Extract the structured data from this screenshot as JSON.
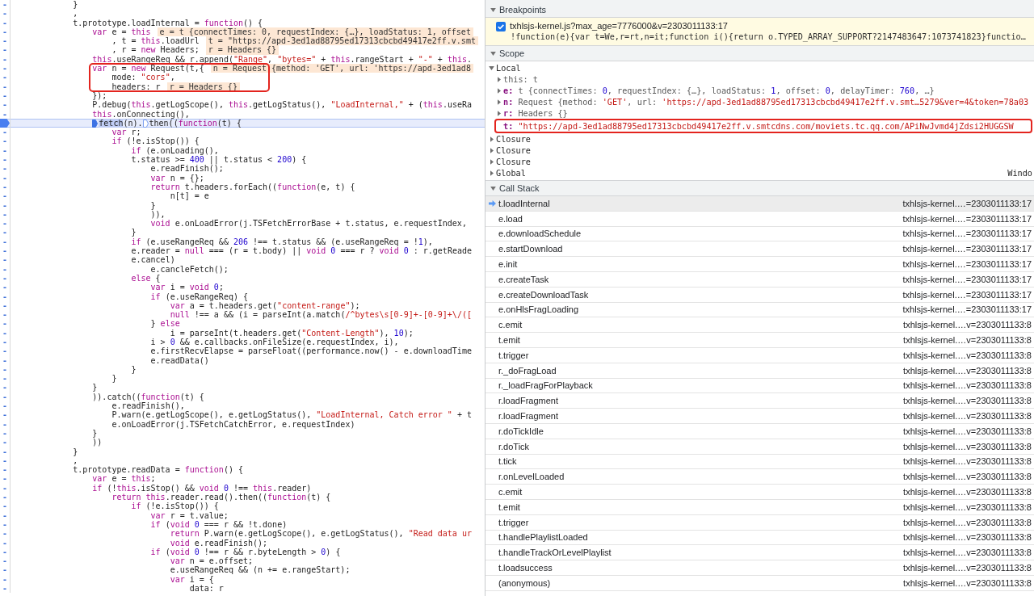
{
  "code_editor": {
    "lines": [
      {
        "gutter": "-",
        "breakpoint": false,
        "current": false,
        "framed": false,
        "code": [
          "}"
        ]
      },
      {
        "gutter": "-",
        "breakpoint": false,
        "current": false,
        "framed": false,
        "code": [
          ","
        ]
      },
      {
        "gutter": "-",
        "breakpoint": false,
        "current": false,
        "framed": false,
        "code": [
          "t.prototype.loadInternal = ",
          {
            "kind": "keyword",
            "text": "function"
          },
          "() {"
        ],
        "children": [
          {
            "gutter": "-",
            "breakpoint": false,
            "current": false,
            "framed": false,
            "code": [
              {
                "kind": "keyword",
                "text": "var"
              },
              " e = ",
              {
                "kind": "keyword",
                "text": "this"
              }
            ],
            "inline_value": "e = t {connectTimes: 0, requestIndex: {…}, loadStatus: 1, offset",
            "children": [
              {
                "gutter": "-",
                "breakpoint": false,
                "current": false,
                "framed": false,
                "code": [
                  ", t = ",
                  {
                    "kind": "keyword",
                    "text": "this"
                  },
                  ".loadUrl"
                ],
                "inline_value": "t = \"https://apd-3ed1ad88795ed17313cbcbd49417e2ff.v.smt"
              },
              {
                "gutter": "-",
                "breakpoint": false,
                "current": false,
                "framed": false,
                "code": [
                  ", r = ",
                  {
                    "kind": "keyword",
                    "text": "new"
                  },
                  " Headers;"
                ],
                "inline_value": "r = Headers {}"
              }
            ]
          },
          {
            "gutter": "-",
            "breakpoint": false,
            "current": false,
            "framed": false,
            "code": [
              {
                "kind": "keyword",
                "text": "this"
              },
              ".useRangeReq && r.append(",
              {
                "kind": "string",
                "text": "\"Range\""
              },
              ", ",
              {
                "kind": "string",
                "text": "\"bytes=\""
              },
              " + ",
              {
                "kind": "keyword",
                "text": "this"
              },
              ".rangeStart + ",
              {
                "kind": "string",
                "text": "\"-\""
              },
              " + ",
              {
                "kind": "keyword",
                "text": "this"
              },
              "."
            ]
          },
          {
            "gutter": "-",
            "breakpoint": false,
            "current": false,
            "framed": true,
            "code": [
              {
                "kind": "keyword",
                "text": "var"
              },
              " n = ",
              {
                "kind": "keyword",
                "text": "new"
              },
              " Request(t,{"
            ],
            "inline_value": "n = Request {method: 'GET', url: 'https://apd-3ed1ad8",
            "children": [
              {
                "gutter": "-",
                "breakpoint": false,
                "current": false,
                "framed": true,
                "code": [
                  "mode: ",
                  {
                    "kind": "string",
                    "text": "\"cors\""
                  },
                  ","
                ]
              },
              {
                "gutter": "-",
                "breakpoint": false,
                "current": false,
                "framed": true,
                "code": [
                  "headers: r"
                ],
                "inline_value": "r = Headers {}"
              }
            ]
          },
          {
            "gutter": "-",
            "breakpoint": false,
            "current": false,
            "framed": false,
            "code": [
              "});"
            ]
          },
          {
            "gutter": "-",
            "breakpoint": false,
            "current": false,
            "framed": false,
            "code": [
              "P.debug(",
              {
                "kind": "keyword",
                "text": "this"
              },
              ".getLogScope(), ",
              {
                "kind": "keyword",
                "text": "this"
              },
              ".getLogStatus(), ",
              {
                "kind": "string",
                "text": "\"LoadInternal,\""
              },
              " + (",
              {
                "kind": "keyword",
                "text": "this"
              },
              ".useRa"
            ]
          },
          {
            "gutter": "-",
            "breakpoint": false,
            "current": false,
            "framed": false,
            "code": [
              {
                "kind": "keyword",
                "text": "this"
              },
              ".onConnecting(),"
            ]
          },
          {
            "breakpoint": true,
            "current": true,
            "framed": false,
            "code": [
              {
                "kind": "marker",
                "active": true
              },
              {
                "kind": "selection",
                "text": "fetch"
              },
              "(n).",
              {
                "kind": "marker",
                "active": false
              },
              "then((",
              {
                "kind": "keyword",
                "text": "function"
              },
              "(t) {"
            ],
            "children": [
              {
                "gutter": "-",
                "breakpoint": false,
                "current": false,
                "framed": false,
                "code": [
                  {
                    "kind": "keyword",
                    "text": "var"
                  },
                  " r;"
                ]
              },
              {
                "gutter": "-",
                "breakpoint": false,
                "current": false,
                "framed": false,
                "code": [
                  {
                    "kind": "keyword",
                    "text": "if"
                  },
                  " (!e.isStop()) {"
                ],
                "children": [
                  {
                    "gutter": "-",
                    "breakpoint": false,
                    "current": false,
                    "framed": false,
                    "code": [
                      {
                        "kind": "keyword",
                        "text": "if"
                      },
                      " (e.onLoading(),"
                    ]
                  },
                  {
                    "gutter": "-",
                    "breakpoint": false,
                    "current": false,
                    "framed": false,
                    "code": [
                      "t.status >= ",
                      {
                        "kind": "number",
                        "text": "400"
                      },
                      " || t.status < ",
                      {
                        "kind": "number",
                        "text": "200"
                      },
                      ") {"
                    ],
                    "children": [
                      {
                        "gutter": "-",
                        "breakpoint": false,
                        "current": false,
                        "framed": false,
                        "code": [
                          "e.readFinish();"
                        ]
                      },
                      {
                        "gutter": "-",
                        "breakpoint": false,
                        "current": false,
                        "framed": false,
                        "code": [
                          {
                            "kind": "keyword",
                            "text": "var"
                          },
                          " n = {};"
                        ]
                      },
                      {
                        "gutter": "-",
                        "breakpoint": false,
                        "current": false,
                        "framed": false,
                        "code": [
                          {
                            "kind": "keyword",
                            "text": "return"
                          },
                          " t.headers.forEach((",
                          {
                            "kind": "keyword",
                            "text": "function"
                          },
                          "(e, t) {"
                        ],
                        "children": [
                          {
                            "gutter": "-",
                            "breakpoint": false,
                            "current": false,
                            "framed": false,
                            "code": [
                              "n[t] = e"
                            ]
                          }
                        ]
                      },
                      {
                        "gutter": "-",
                        "breakpoint": false,
                        "current": false,
                        "framed": false,
                        "code": [
                          "}"
                        ]
                      },
                      {
                        "gutter": "-",
                        "breakpoint": false,
                        "current": false,
                        "framed": false,
                        "code": [
                          ")),"
                        ]
                      },
                      {
                        "gutter": "-",
                        "breakpoint": false,
                        "current": false,
                        "framed": false,
                        "code": [
                          {
                            "kind": "keyword",
                            "text": "void"
                          },
                          " e.onLoadError(j.TSFetchErrorBase + t.status, e.requestIndex,"
                        ]
                      }
                    ]
                  },
                  {
                    "gutter": "-",
                    "breakpoint": false,
                    "current": false,
                    "framed": false,
                    "code": [
                      "}"
                    ]
                  },
                  {
                    "gutter": "-",
                    "breakpoint": false,
                    "current": false,
                    "framed": false,
                    "code": [
                      {
                        "kind": "keyword",
                        "text": "if"
                      },
                      " (e.useRangeReq && ",
                      {
                        "kind": "number",
                        "text": "206"
                      },
                      " !== t.status && (e.useRangeReq = !",
                      {
                        "kind": "number",
                        "text": "1"
                      },
                      "),"
                    ]
                  },
                  {
                    "gutter": "-",
                    "breakpoint": false,
                    "current": false,
                    "framed": false,
                    "code": [
                      "e.reader = ",
                      {
                        "kind": "keyword",
                        "text": "null"
                      },
                      " === (r = t.body) || ",
                      {
                        "kind": "keyword",
                        "text": "void "
                      },
                      {
                        "kind": "number",
                        "text": "0"
                      },
                      " === r ? ",
                      {
                        "kind": "keyword",
                        "text": "void "
                      },
                      {
                        "kind": "number",
                        "text": "0"
                      },
                      " : r.getReade"
                    ]
                  },
                  {
                    "gutter": "-",
                    "breakpoint": false,
                    "current": false,
                    "framed": false,
                    "code": [
                      "e.cancel)"
                    ],
                    "children": [
                      {
                        "gutter": "-",
                        "breakpoint": false,
                        "current": false,
                        "framed": false,
                        "code": [
                          "e.cancleFetch();"
                        ]
                      }
                    ]
                  },
                  {
                    "gutter": "-",
                    "breakpoint": false,
                    "current": false,
                    "framed": false,
                    "code": [
                      {
                        "kind": "keyword",
                        "text": "else"
                      },
                      " {"
                    ],
                    "children": [
                      {
                        "gutter": "-",
                        "breakpoint": false,
                        "current": false,
                        "framed": false,
                        "code": [
                          {
                            "kind": "keyword",
                            "text": "var"
                          },
                          " i = ",
                          {
                            "kind": "keyword",
                            "text": "void "
                          },
                          {
                            "kind": "number",
                            "text": "0"
                          },
                          ";"
                        ]
                      },
                      {
                        "gutter": "-",
                        "breakpoint": false,
                        "current": false,
                        "framed": false,
                        "code": [
                          {
                            "kind": "keyword",
                            "text": "if"
                          },
                          " (e.useRangeReq) {"
                        ],
                        "children": [
                          {
                            "gutter": "-",
                            "breakpoint": false,
                            "current": false,
                            "framed": false,
                            "code": [
                              {
                                "kind": "keyword",
                                "text": "var"
                              },
                              " a = t.headers.get(",
                              {
                                "kind": "string",
                                "text": "\"content-range\""
                              },
                              ");"
                            ]
                          },
                          {
                            "gutter": "-",
                            "breakpoint": false,
                            "current": false,
                            "framed": false,
                            "code": [
                              {
                                "kind": "keyword",
                                "text": "null"
                              },
                              " !== a && (i = parseInt(a.match(",
                              {
                                "kind": "regex",
                                "text": "/^bytes\\s[0-9]+-[0-9]+\\/(["
                              }
                            ]
                          }
                        ]
                      },
                      {
                        "gutter": "-",
                        "breakpoint": false,
                        "current": false,
                        "framed": false,
                        "code": [
                          "} ",
                          {
                            "kind": "keyword",
                            "text": "else"
                          }
                        ],
                        "children": [
                          {
                            "gutter": "-",
                            "breakpoint": false,
                            "current": false,
                            "framed": false,
                            "code": [
                              "i = parseInt(t.headers.get(",
                              {
                                "kind": "string",
                                "text": "\"Content-Length\""
                              },
                              "), ",
                              {
                                "kind": "number",
                                "text": "10"
                              },
                              ");"
                            ]
                          }
                        ]
                      },
                      {
                        "gutter": "-",
                        "breakpoint": false,
                        "current": false,
                        "framed": false,
                        "code": [
                          "i > ",
                          {
                            "kind": "number",
                            "text": "0"
                          },
                          " && e.callbacks.onFileSize(e.requestIndex, i),"
                        ]
                      },
                      {
                        "gutter": "-",
                        "breakpoint": false,
                        "current": false,
                        "framed": false,
                        "code": [
                          "e.firstRecvElapse = parseFloat((performance.now() - e.downloadTime"
                        ]
                      },
                      {
                        "gutter": "-",
                        "breakpoint": false,
                        "current": false,
                        "framed": false,
                        "code": [
                          "e.readData()"
                        ]
                      }
                    ]
                  },
                  {
                    "gutter": "-",
                    "breakpoint": false,
                    "current": false,
                    "framed": false,
                    "code": [
                      "}"
                    ]
                  }
                ]
              },
              {
                "gutter": "-",
                "breakpoint": false,
                "current": false,
                "framed": false,
                "code": [
                  "}"
                ]
              }
            ]
          },
          {
            "gutter": "-",
            "breakpoint": false,
            "current": false,
            "framed": false,
            "code": [
              "}"
            ]
          },
          {
            "gutter": "-",
            "breakpoint": false,
            "current": false,
            "framed": false,
            "code": [
              ")).catch((",
              {
                "kind": "keyword",
                "text": "function"
              },
              "(t) {"
            ],
            "children": [
              {
                "gutter": "-",
                "breakpoint": false,
                "current": false,
                "framed": false,
                "code": [
                  "e.readFinish(),"
                ]
              },
              {
                "gutter": "-",
                "breakpoint": false,
                "current": false,
                "framed": false,
                "code": [
                  "P.warn(e.getLogScope(), e.getLogStatus(), ",
                  {
                    "kind": "string",
                    "text": "\"LoadInternal, Catch error \""
                  },
                  " + t"
                ]
              },
              {
                "gutter": "-",
                "breakpoint": false,
                "current": false,
                "framed": false,
                "code": [
                  "e.onLoadError(j.TSFetchCatchError, e.requestIndex)"
                ]
              }
            ]
          },
          {
            "gutter": "-",
            "breakpoint": false,
            "current": false,
            "framed": false,
            "code": [
              "}"
            ]
          },
          {
            "gutter": "-",
            "breakpoint": false,
            "current": false,
            "framed": false,
            "code": [
              "))"
            ]
          }
        ]
      },
      {
        "gutter": "-",
        "breakpoint": false,
        "current": false,
        "framed": false,
        "code": [
          "}"
        ]
      },
      {
        "gutter": "-",
        "breakpoint": false,
        "current": false,
        "framed": false,
        "code": [
          ","
        ]
      },
      {
        "gutter": "-",
        "breakpoint": false,
        "current": false,
        "framed": false,
        "code": [
          "t.prototype.readData = ",
          {
            "kind": "keyword",
            "text": "function"
          },
          "() {"
        ],
        "children": [
          {
            "gutter": "-",
            "breakpoint": false,
            "current": false,
            "framed": false,
            "code": [
              {
                "kind": "keyword",
                "text": "var"
              },
              " e = ",
              {
                "kind": "keyword",
                "text": "this"
              },
              ";"
            ]
          },
          {
            "gutter": "-",
            "breakpoint": false,
            "current": false,
            "framed": false,
            "code": [
              {
                "kind": "keyword",
                "text": "if"
              },
              " (!",
              {
                "kind": "keyword",
                "text": "this"
              },
              ".isStop() && ",
              {
                "kind": "keyword",
                "text": "void "
              },
              {
                "kind": "number",
                "text": "0"
              },
              " !== ",
              {
                "kind": "keyword",
                "text": "this"
              },
              ".reader)"
            ],
            "children": [
              {
                "gutter": "-",
                "breakpoint": false,
                "current": false,
                "framed": false,
                "code": [
                  {
                    "kind": "keyword",
                    "text": "return this"
                  },
                  ".reader.read().then((",
                  {
                    "kind": "keyword",
                    "text": "function"
                  },
                  "(t) {"
                ],
                "children": [
                  {
                    "gutter": "-",
                    "breakpoint": false,
                    "current": false,
                    "framed": false,
                    "code": [
                      {
                        "kind": "keyword",
                        "text": "if"
                      },
                      " (!e.isStop()) {"
                    ],
                    "children": [
                      {
                        "gutter": "-",
                        "breakpoint": false,
                        "current": false,
                        "framed": false,
                        "code": [
                          {
                            "kind": "keyword",
                            "text": "var"
                          },
                          " r = t.value;"
                        ]
                      },
                      {
                        "gutter": "-",
                        "breakpoint": false,
                        "current": false,
                        "framed": false,
                        "code": [
                          {
                            "kind": "keyword",
                            "text": "if"
                          },
                          " (",
                          {
                            "kind": "keyword",
                            "text": "void "
                          },
                          {
                            "kind": "number",
                            "text": "0"
                          },
                          " === r && !t.done)"
                        ],
                        "children": [
                          {
                            "gutter": "-",
                            "breakpoint": false,
                            "current": false,
                            "framed": false,
                            "code": [
                              {
                                "kind": "keyword",
                                "text": "return"
                              },
                              " P.warn(e.getLogScope(), e.getLogStatus(), ",
                              {
                                "kind": "string",
                                "text": "\"Read data ur"
                              }
                            ]
                          },
                          {
                            "gutter": "-",
                            "breakpoint": false,
                            "current": false,
                            "framed": false,
                            "code": [
                              {
                                "kind": "keyword",
                                "text": "void"
                              },
                              " e.readFinish();"
                            ]
                          }
                        ]
                      },
                      {
                        "gutter": "-",
                        "breakpoint": false,
                        "current": false,
                        "framed": false,
                        "code": [
                          {
                            "kind": "keyword",
                            "text": "if"
                          },
                          " (",
                          {
                            "kind": "keyword",
                            "text": "void "
                          },
                          {
                            "kind": "number",
                            "text": "0"
                          },
                          " !== r && r.byteLength > ",
                          {
                            "kind": "number",
                            "text": "0"
                          },
                          ") {"
                        ],
                        "children": [
                          {
                            "gutter": "-",
                            "breakpoint": false,
                            "current": false,
                            "framed": false,
                            "code": [
                              {
                                "kind": "keyword",
                                "text": "var"
                              },
                              " n = e.offset;"
                            ]
                          },
                          {
                            "gutter": "-",
                            "breakpoint": false,
                            "current": false,
                            "framed": false,
                            "code": [
                              "e.useRangeReq && (n += e.rangeStart);"
                            ]
                          },
                          {
                            "gutter": "-",
                            "breakpoint": false,
                            "current": false,
                            "framed": false,
                            "code": [
                              {
                                "kind": "keyword",
                                "text": "var"
                              },
                              " i = {"
                            ],
                            "children": [
                              {
                                "gutter": "-",
                                "breakpoint": false,
                                "current": false,
                                "framed": false,
                                "code": [
                                  "data: r"
                                ]
                              }
                            ]
                          }
                        ]
                      }
                    ]
                  }
                ]
              }
            ]
          }
        ]
      }
    ]
  },
  "sidebar": {
    "breakpoints": {
      "title": "Breakpoints",
      "expanded": true,
      "items": [
        {
          "checked": true,
          "location": "txhlsjs-kernel.js?max_age=7776000&v=2303011133:17",
          "snippet": "!function(e){var t=We,r=rt,n=it;function i(){return o.TYPED_ARRAY_SUPPORT?2147483647:1073741823}functio…"
        }
      ]
    },
    "scope": {
      "title": "Scope",
      "expanded": true,
      "items": [
        {
          "kind": "group",
          "label": "Local",
          "expanded": true,
          "children": [
            {
              "kind": "property",
              "expanded": false,
              "framed": false,
              "entry": [
                "this: t"
              ]
            },
            {
              "kind": "property",
              "expanded": false,
              "framed": false,
              "entry": [
                {
                  "kind": "name",
                  "text": "e:"
                },
                " t {connectTimes: ",
                {
                  "kind": "number",
                  "text": "0"
                },
                ", requestIndex: {…}, loadStatus: ",
                {
                  "kind": "number",
                  "text": "1"
                },
                ", offset: ",
                {
                  "kind": "number",
                  "text": "0"
                },
                ", delayTimer: ",
                {
                  "kind": "number",
                  "text": "760"
                },
                ", …}"
              ]
            },
            {
              "kind": "property",
              "expanded": false,
              "framed": false,
              "entry": [
                {
                  "kind": "name",
                  "text": "n:"
                },
                " Request {method: ",
                {
                  "kind": "string",
                  "text": "'GET'"
                },
                ", url: ",
                {
                  "kind": "string",
                  "text": "'https://apd-3ed1ad88795ed17313cbcbd49417e2ff.v.smt…5279&ver=4&token=78a03"
                }
              ]
            },
            {
              "kind": "property",
              "expanded": false,
              "framed": false,
              "entry": [
                {
                  "kind": "name",
                  "text": "r:"
                },
                " Headers {}"
              ]
            },
            {
              "kind": "primitive",
              "framed": true,
              "entry": [
                {
                  "kind": "name",
                  "text": "t:"
                },
                {
                  "kind": "string",
                  "text": " \"https://apd-3ed1ad88795ed17313cbcbd49417e2ff.v.smtcdns.com/moviets.tc.qq.com/APiNwJvmd4jZdsi2HUGGSW"
                }
              ]
            }
          ]
        },
        {
          "kind": "group",
          "label": "Closure",
          "expanded": false
        },
        {
          "kind": "group",
          "label": "Closure",
          "expanded": false
        },
        {
          "kind": "group",
          "label": "Closure",
          "expanded": false
        },
        {
          "kind": "group",
          "label": "Global",
          "expanded": false,
          "value": "Windo"
        }
      ]
    },
    "call_stack": {
      "title": "Call Stack",
      "expanded": true,
      "items": [
        {
          "name": "t.loadInternal",
          "location": "txhlsjs-kernel.…=2303011133:17",
          "selected": true
        },
        {
          "name": "e.load",
          "location": "txhlsjs-kernel.…=2303011133:17",
          "selected": false
        },
        {
          "name": "e.downloadSchedule",
          "location": "txhlsjs-kernel.…=2303011133:17",
          "selected": false
        },
        {
          "name": "e.startDownload",
          "location": "txhlsjs-kernel.…=2303011133:17",
          "selected": false
        },
        {
          "name": "e.init",
          "location": "txhlsjs-kernel.…=2303011133:17",
          "selected": false
        },
        {
          "name": "e.createTask",
          "location": "txhlsjs-kernel.…=2303011133:17",
          "selected": false
        },
        {
          "name": "e.createDownloadTask",
          "location": "txhlsjs-kernel.…=2303011133:17",
          "selected": false
        },
        {
          "name": "e.onHlsFragLoading",
          "location": "txhlsjs-kernel.…=2303011133:17",
          "selected": false
        },
        {
          "name": "c.emit",
          "location": "txhlsjs-kernel.…v=2303011133:8",
          "selected": false
        },
        {
          "name": "t.emit",
          "location": "txhlsjs-kernel.…v=2303011133:8",
          "selected": false
        },
        {
          "name": "t.trigger",
          "location": "txhlsjs-kernel.…v=2303011133:8",
          "selected": false
        },
        {
          "name": "r._doFragLoad",
          "location": "txhlsjs-kernel.…v=2303011133:8",
          "selected": false
        },
        {
          "name": "r._loadFragForPlayback",
          "location": "txhlsjs-kernel.…v=2303011133:8",
          "selected": false
        },
        {
          "name": "r.loadFragment",
          "location": "txhlsjs-kernel.…v=2303011133:8",
          "selected": false
        },
        {
          "name": "r.loadFragment",
          "location": "txhlsjs-kernel.…v=2303011133:8",
          "selected": false
        },
        {
          "name": "r.doTickIdle",
          "location": "txhlsjs-kernel.…v=2303011133:8",
          "selected": false
        },
        {
          "name": "r.doTick",
          "location": "txhlsjs-kernel.…v=2303011133:8",
          "selected": false
        },
        {
          "name": "t.tick",
          "location": "txhlsjs-kernel.…v=2303011133:8",
          "selected": false
        },
        {
          "name": "r.onLevelLoaded",
          "location": "txhlsjs-kernel.…v=2303011133:8",
          "selected": false
        },
        {
          "name": "c.emit",
          "location": "txhlsjs-kernel.…v=2303011133:8",
          "selected": false
        },
        {
          "name": "t.emit",
          "location": "txhlsjs-kernel.…v=2303011133:8",
          "selected": false
        },
        {
          "name": "t.trigger",
          "location": "txhlsjs-kernel.…v=2303011133:8",
          "selected": false
        },
        {
          "name": "t.handlePlaylistLoaded",
          "location": "txhlsjs-kernel.…v=2303011133:8",
          "selected": false
        },
        {
          "name": "t.handleTrackOrLevelPlaylist",
          "location": "txhlsjs-kernel.…v=2303011133:8",
          "selected": false
        },
        {
          "name": "t.loadsuccess",
          "location": "txhlsjs-kernel.…v=2303011133:8",
          "selected": false
        },
        {
          "name": "(anonymous)",
          "location": "txhlsjs-kernel.…v=2303011133:8",
          "selected": false
        }
      ]
    }
  }
}
